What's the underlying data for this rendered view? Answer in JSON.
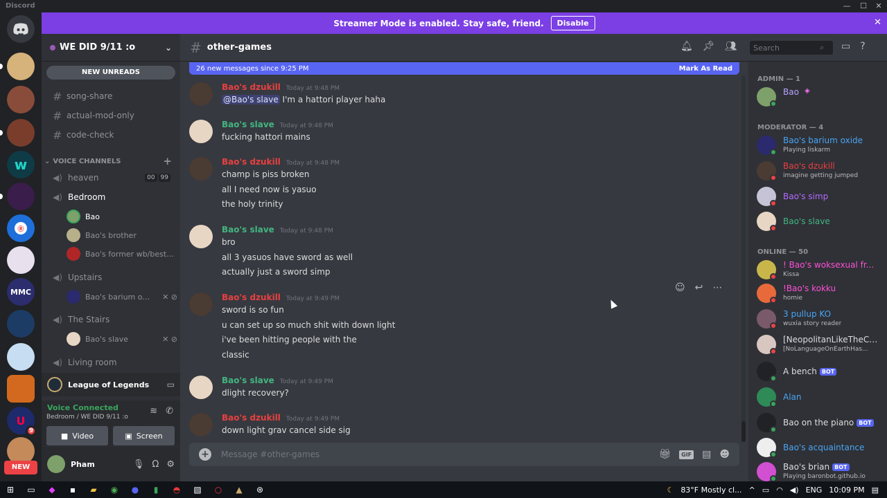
{
  "app": {
    "name": "Discord"
  },
  "colors": {
    "accent": "#5865f2",
    "banner": "#7b3fe4",
    "online": "#3ba55d",
    "dnd": "#ed4245",
    "red_role": "#e84040",
    "green_role": "#43b581",
    "blue_role": "#4aa4f2",
    "pink_role": "#ff4fd8",
    "purple_role": "#9b7cf0"
  },
  "banner": {
    "text": "Streamer Mode is enabled. Stay safe, friend.",
    "button": "Disable"
  },
  "guilds": {
    "new_label": "NEW",
    "badge_a": "9"
  },
  "server": {
    "name": "WE DID 9/11 :o",
    "new_unreads": "NEW UNREADS"
  },
  "channels": {
    "text": [
      "song-share",
      "actual-mod-only",
      "code-check"
    ],
    "voice_category": "VOICE CHANNELS",
    "voice": [
      {
        "name": "heaven",
        "counts": [
          "00",
          "99"
        ]
      },
      {
        "name": "Bedroom",
        "users": [
          "Bao",
          "Bao's brother",
          "Bao's former wb/best fri..."
        ]
      },
      {
        "name": "Upstairs",
        "users": [
          "Bao's barium oxi..."
        ]
      },
      {
        "name": "The Stairs",
        "users": [
          "Bao's slave"
        ]
      },
      {
        "name": "Living room"
      }
    ]
  },
  "activity": {
    "game": "League of Legends"
  },
  "voice_panel": {
    "status": "Voice Connected",
    "location": "Bedroom / WE DID 9/11 :o",
    "video": "Video",
    "screen": "Screen"
  },
  "user_panel": {
    "name": "Pham"
  },
  "chat": {
    "channel": "other-games",
    "new_messages": "26 new messages since 9:25 PM",
    "mark_read": "Mark As Read",
    "composer_placeholder": "Message #other-games",
    "messages": [
      {
        "author": "Bao's dzukill",
        "time": "Today at 9:48 PM",
        "mention": "@Bao's slave",
        "lines": [
          "I'm a hattori player haha"
        ]
      },
      {
        "author": "Bao's slave",
        "time": "Today at 9:48 PM",
        "lines": [
          "fucking hattori mains"
        ]
      },
      {
        "author": "Bao's dzukill",
        "time": "Today at 9:48 PM",
        "lines": [
          "champ is piss broken",
          "all I need now is yasuo",
          "the holy trinity"
        ]
      },
      {
        "author": "Bao's slave",
        "time": "Today at 9:48 PM",
        "lines": [
          "bro",
          "all 3 yasuos have sword as well",
          "actually just a sword simp"
        ]
      },
      {
        "author": "Bao's dzukill",
        "time": "Today at 9:49 PM",
        "lines": [
          "sword is so fun",
          "u can set up so much shit with down light",
          "i've been hitting people with the",
          "classic"
        ]
      },
      {
        "author": "Bao's slave",
        "time": "Today at 9:49 PM",
        "lines": [
          "dlight recovery?"
        ]
      },
      {
        "author": "Bao's dzukill",
        "time": "Today at 9:49 PM",
        "lines": [
          "down light grav cancel side sig"
        ]
      }
    ]
  },
  "search": {
    "placeholder": "Search"
  },
  "members": {
    "cat_admin": "ADMIN — 1",
    "cat_mod": "MODERATOR — 4",
    "cat_online": "ONLINE — 50",
    "admin": [
      {
        "name": "Bao"
      }
    ],
    "mods": [
      {
        "name": "Bao's barium oxide",
        "activity": "Playing liskarm"
      },
      {
        "name": "Bao's dzukill",
        "activity": "imagine getting jumped"
      },
      {
        "name": "Bao's simp"
      },
      {
        "name": "Bao's slave"
      }
    ],
    "online": [
      {
        "name": "! Bao's woksexual fr...",
        "activity": "Kissa"
      },
      {
        "name": "!Bao's kokku",
        "activity": "homie"
      },
      {
        "name": "3 pullup KO",
        "activity": "wuxia story reader"
      },
      {
        "name": "[NeopolitanLikeTheCh...",
        "activity": "[NoLanguageOnEarthHas..."
      },
      {
        "name": "A bench",
        "bot": "BOT"
      },
      {
        "name": "Alan"
      },
      {
        "name": "Bao on the piano",
        "bot": "BOT"
      },
      {
        "name": "Bao's acquaintance"
      },
      {
        "name": "Bao's brian",
        "bot": "BOT",
        "activity": "Playing baronbot.github.io"
      }
    ]
  },
  "taskbar": {
    "weather": "83°F  Mostly cl...",
    "lang": "ENG",
    "time": "10:09 PM"
  }
}
